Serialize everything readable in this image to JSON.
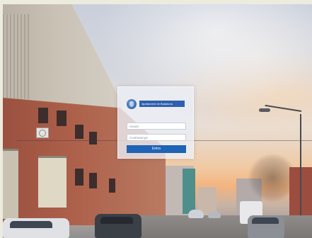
{
  "login": {
    "logo_text": "Ajuntament de Badalona",
    "username_placeholder": "Usuari",
    "password_placeholder": "Contrasenya",
    "submit_label": "Entra"
  },
  "icons": {
    "logo": "municipal-seal-icon"
  },
  "colors": {
    "brand_blue": "#2f5fae",
    "button_blue": "#1e63b5",
    "panel_bg": "#ecf0f7"
  }
}
